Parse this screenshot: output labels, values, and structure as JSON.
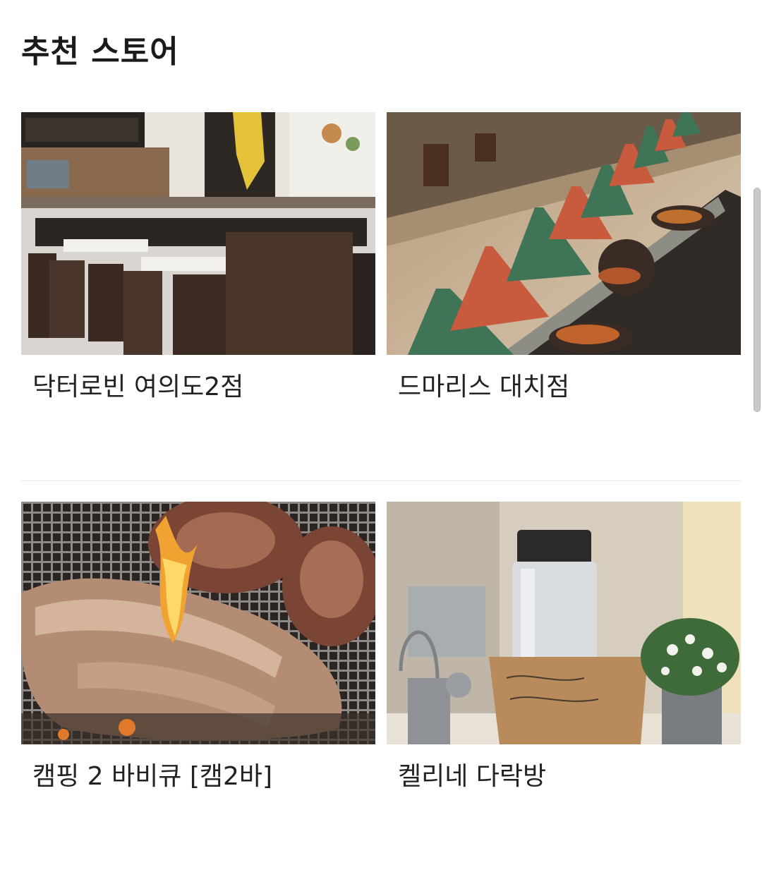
{
  "section": {
    "title": "추천 스토어"
  },
  "stores": [
    {
      "name": "닥터로빈 여의도2점",
      "image_icon": "cafe-interior-photo"
    },
    {
      "name": "드마리스 대치점",
      "image_icon": "tagine-buffet-photo"
    },
    {
      "name": "캠핑 2 바비큐 [캠2바]",
      "image_icon": "grilled-meat-photo"
    },
    {
      "name": "켈리네 다락방",
      "image_icon": "tumbler-cafe-photo"
    }
  ]
}
